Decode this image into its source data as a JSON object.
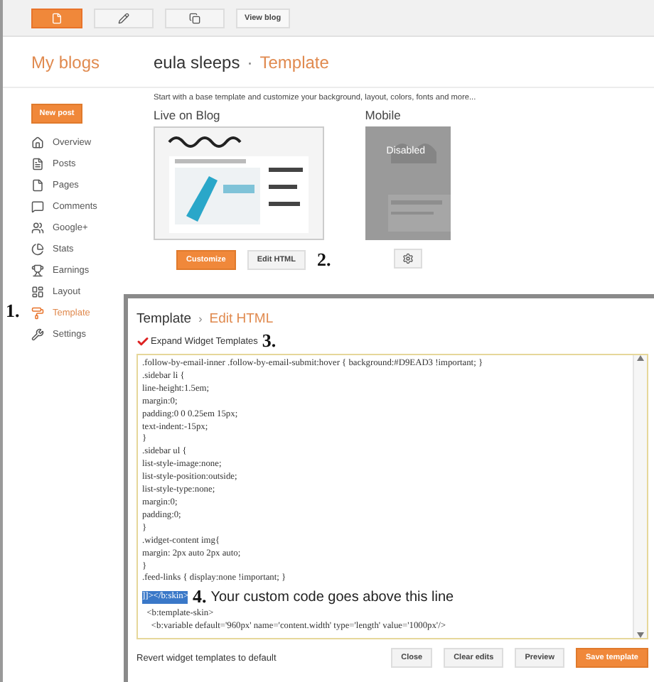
{
  "toolbar": {
    "view_blog": "View blog"
  },
  "header": {
    "title": "My blogs",
    "blog_name": "eula sleeps",
    "separator": "·",
    "page": "Template"
  },
  "sidebar": {
    "new_post": "New post",
    "items": [
      {
        "label": "Overview",
        "selected": false
      },
      {
        "label": "Posts",
        "selected": false
      },
      {
        "label": "Pages",
        "selected": false
      },
      {
        "label": "Comments",
        "selected": false
      },
      {
        "label": "Google+",
        "selected": false
      },
      {
        "label": "Stats",
        "selected": false
      },
      {
        "label": "Earnings",
        "selected": false
      },
      {
        "label": "Layout",
        "selected": false
      },
      {
        "label": "Template",
        "selected": true,
        "annotation": "1."
      },
      {
        "label": "Settings",
        "selected": false
      }
    ]
  },
  "main": {
    "intro": "Start with a base template and customize your background, layout, colors, fonts and more...",
    "live": {
      "title": "Live on Blog",
      "customize": "Customize",
      "edit_html": "Edit HTML",
      "annotation": "2."
    },
    "mobile": {
      "title": "Mobile",
      "status": "Disabled"
    }
  },
  "dialog": {
    "breadcrumb": [
      "Template",
      "Edit HTML"
    ],
    "separator": "›",
    "expand": {
      "label": "Expand Widget Templates",
      "checked": true,
      "annotation": "3."
    },
    "code_lines": [
      {
        "text": ".follow-by-email-inner .follow-by-email-submit:hover { background:#D9EAD3 !important; }",
        "highlighted": false
      },
      {
        "text": ".sidebar li {",
        "highlighted": false
      },
      {
        "text": "line-height:1.5em;",
        "highlighted": false
      },
      {
        "text": "margin:0;",
        "highlighted": false
      },
      {
        "text": "padding:0 0 0.25em 15px;",
        "highlighted": false
      },
      {
        "text": "text-indent:-15px;",
        "highlighted": false
      },
      {
        "text": "}",
        "highlighted": false
      },
      {
        "text": ".sidebar ul {",
        "highlighted": false
      },
      {
        "text": "list-style-image:none;",
        "highlighted": false
      },
      {
        "text": "list-style-position:outside;",
        "highlighted": false
      },
      {
        "text": "list-style-type:none;",
        "highlighted": false
      },
      {
        "text": "margin:0;",
        "highlighted": false
      },
      {
        "text": "padding:0;",
        "highlighted": false
      },
      {
        "text": "}",
        "highlighted": false
      },
      {
        "text": ".widget-content img{",
        "highlighted": false
      },
      {
        "text": "margin: 2px auto 2px auto;",
        "highlighted": false
      },
      {
        "text": "}",
        "highlighted": false
      },
      {
        "text": ".feed-links { display:none !important; }",
        "highlighted": false
      },
      {
        "text": "]]></b:skin>",
        "highlighted": true,
        "annotation_number": "4.",
        "annotation": "Your custom code goes above this line"
      },
      {
        "text": "  <b:template-skin>",
        "highlighted": false
      },
      {
        "text": "    <b:variable default='960px' name='content.width' type='length' value='1000px'/>",
        "highlighted": false
      }
    ],
    "footer": {
      "revert": "Revert widget templates to default",
      "buttons": [
        {
          "label": "Close",
          "primary": false
        },
        {
          "label": "Clear edits",
          "primary": false
        },
        {
          "label": "Preview",
          "primary": false
        },
        {
          "label": "Save template",
          "primary": true
        }
      ]
    }
  }
}
